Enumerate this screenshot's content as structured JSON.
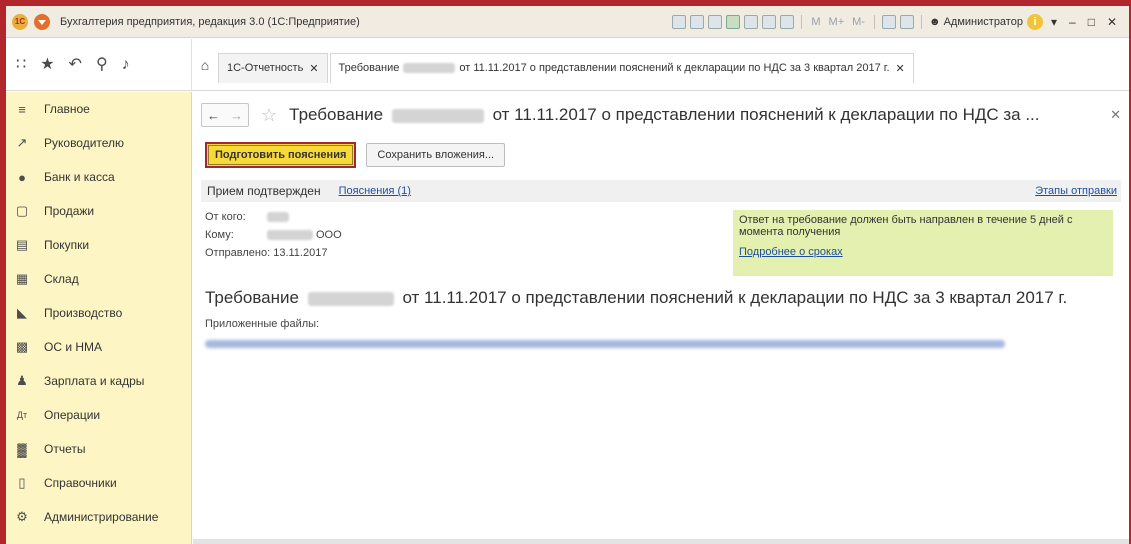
{
  "titlebar": {
    "logo": "1С",
    "title": "Бухгалтерия предприятия, редакция 3.0  (1С:Предприятие)",
    "tool_m": "M",
    "tool_mplus": "M+",
    "tool_mminus": "M-",
    "user": "Администратор",
    "info": "i"
  },
  "tabs": [
    {
      "label": "1С-Отчетность"
    },
    {
      "label_start": "Требование",
      "label_end": "от 11.11.2017 о представлении пояснений к декларации по НДС за 3 квартал 2017 г."
    }
  ],
  "sidebar": {
    "items": [
      {
        "label": "Главное",
        "icon": "menu-icon"
      },
      {
        "label": "Руководителю",
        "icon": "chart-trend-icon"
      },
      {
        "label": "Банк и касса",
        "icon": "bank-icon"
      },
      {
        "label": "Продажи",
        "icon": "sales-icon"
      },
      {
        "label": "Покупки",
        "icon": "cart-icon"
      },
      {
        "label": "Склад",
        "icon": "warehouse-icon"
      },
      {
        "label": "Производство",
        "icon": "factory-icon"
      },
      {
        "label": "ОС и НМА",
        "icon": "truck-icon"
      },
      {
        "label": "Зарплата и кадры",
        "icon": "person-icon"
      },
      {
        "label": "Операции",
        "icon": "operations-icon"
      },
      {
        "label": "Отчеты",
        "icon": "bar-chart-icon"
      },
      {
        "label": "Справочники",
        "icon": "book-icon"
      },
      {
        "label": "Администрирование",
        "icon": "gear-icon"
      }
    ]
  },
  "document": {
    "title_start": "Требование",
    "title_end": "от 11.11.2017 о представлении пояснений к декларации по НДС за ...",
    "prepare_button": "Подготовить пояснения",
    "save_attachments_button": "Сохранить вложения...",
    "status": "Прием подтвержден",
    "explanations_link": "Пояснения (1)",
    "stages_link": "Этапы отправки",
    "from_label": "От кого:",
    "to_label": "Кому:",
    "to_suffix": "ООО",
    "sent": "Отправлено: 13.11.2017",
    "notice_text": "Ответ на требование должен быть направлен в течение 5 дней с момента получения",
    "notice_link": "Подробнее о сроках",
    "requirement_start": "Требование",
    "requirement_end": "от 11.11.2017 о представлении пояснений к декларации по НДС за 3 квартал 2017 г.",
    "attached_label": "Приложенные файлы:"
  },
  "colors": {
    "accent_yellow": "#f8d93a",
    "frame_red": "#b2252a",
    "sidebar_bg": "#fdf6c4",
    "notice_bg": "#e4f0b0",
    "link": "#1f4e9c"
  }
}
